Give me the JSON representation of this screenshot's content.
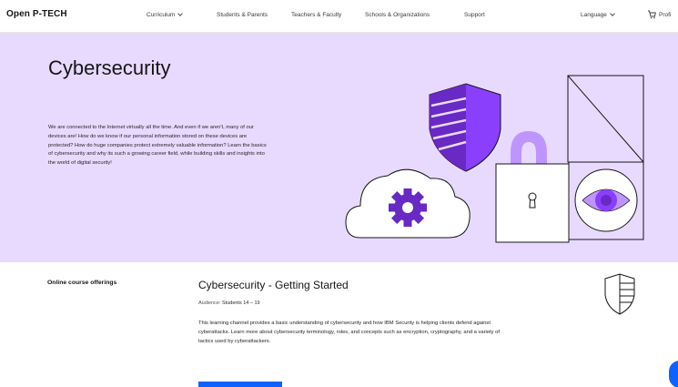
{
  "nav": {
    "logo": "Open P-TECH",
    "links": [
      "Curriculum",
      "Students & Parents",
      "Teachers & Faculty",
      "Schools & Organizations",
      "Support"
    ],
    "language": "Language",
    "profile": "Profi"
  },
  "hero": {
    "title": "Cybersecurity",
    "description": "We are connected to the Internet virtually all the time. And even if we aren't, many of our devices are! How do we know if our personal information stored on these devices are protected? How do huge companies protect extremely valuable information? Learn the basics of cybersecurity and why its such a growing career field, while building skills and insights into the world of digital security!"
  },
  "offerings": {
    "label": "Online course offerings",
    "course_title": "Cybersecurity - Getting Started",
    "audience_label": "Audience:",
    "audience_value": "Students 14 – 19",
    "description": "This learning channel provides a basic understanding of cybersecurity and how IBM Security is helping clients defend against cyberattacks. Learn more about cybersecurity terminology, roles, and concepts such as encryption, cryptography, and a variety of tactics used by cyberattackers."
  },
  "colors": {
    "hero_bg": "#e8daff",
    "purple": "#8a3ffc",
    "deep_purple": "#6929c4",
    "light_purple": "#be95ff",
    "accent_blue": "#0f62fe"
  },
  "icons": [
    "chevron-down-icon",
    "cart-icon",
    "shield-icon",
    "gear-icon",
    "padlock-icon",
    "eye-icon",
    "keyhole-icon"
  ]
}
